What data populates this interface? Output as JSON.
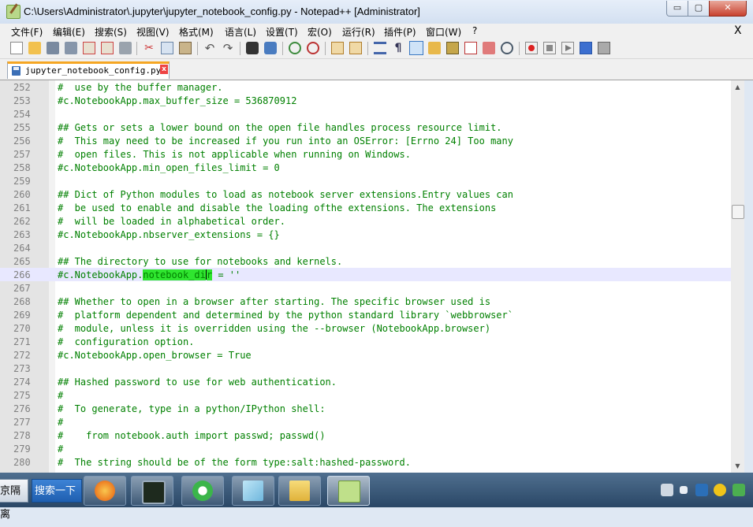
{
  "window": {
    "title": "C:\\Users\\Administrator\\.jupyter\\jupyter_notebook_config.py - Notepad++ [Administrator]",
    "min_glyph": "▭",
    "max_glyph": "▢",
    "close_glyph": "✕"
  },
  "menu": {
    "items": [
      "文件(F)",
      "编辑(E)",
      "搜索(S)",
      "视图(V)",
      "格式(M)",
      "语言(L)",
      "设置(T)",
      "宏(O)",
      "运行(R)",
      "插件(P)",
      "窗口(W)",
      "?"
    ],
    "close_glyph": "X"
  },
  "toolbar": {
    "icons": [
      "new-file-icon",
      "open-file-icon",
      "save-icon",
      "save-all-icon",
      "close-icon",
      "close-all-icon",
      "print-icon",
      "cut-icon",
      "copy-icon",
      "paste-icon",
      "undo-icon",
      "redo-icon",
      "find-icon",
      "replace-icon",
      "zoom-in-icon",
      "zoom-out-icon",
      "sync-vertical-icon",
      "sync-horizontal-icon",
      "word-wrap-icon",
      "show-all-chars-icon",
      "indent-guide-icon",
      "user-lang-icon",
      "doc-map-icon",
      "function-list-icon",
      "folder-workspace-icon",
      "monitor-icon",
      "record-macro-icon",
      "stop-record-icon",
      "play-macro-icon",
      "run-macro-multiple-icon",
      "save-macro-icon"
    ]
  },
  "tab": {
    "label": "jupyter_notebook_config.py",
    "close_glyph": "x"
  },
  "editor": {
    "lines": [
      {
        "n": "252",
        "text": "#  use by the buffer manager."
      },
      {
        "n": "253",
        "text": "#c.NotebookApp.max_buffer_size = 536870912"
      },
      {
        "n": "254",
        "text": ""
      },
      {
        "n": "255",
        "text": "## Gets or sets a lower bound on the open file handles process resource limit."
      },
      {
        "n": "256",
        "text": "#  This may need to be increased if you run into an OSError: [Errno 24] Too many"
      },
      {
        "n": "257",
        "text": "#  open files. This is not applicable when running on Windows."
      },
      {
        "n": "258",
        "text": "#c.NotebookApp.min_open_files_limit = 0"
      },
      {
        "n": "259",
        "text": ""
      },
      {
        "n": "260",
        "text": "## Dict of Python modules to load as notebook server extensions.Entry values can"
      },
      {
        "n": "261",
        "text": "#  be used to enable and disable the loading ofthe extensions. The extensions"
      },
      {
        "n": "262",
        "text": "#  will be loaded in alphabetical order."
      },
      {
        "n": "263",
        "text": "#c.NotebookApp.nbserver_extensions = {}"
      },
      {
        "n": "264",
        "text": ""
      },
      {
        "n": "265",
        "text": "## The directory to use for notebooks and kernels."
      },
      {
        "n": "266",
        "text": "",
        "pre": "#c.NotebookApp.",
        "hl1": "notebook_di",
        "hl2": "r",
        "post": " = ''"
      },
      {
        "n": "267",
        "text": ""
      },
      {
        "n": "268",
        "text": "## Whether to open in a browser after starting. The specific browser used is"
      },
      {
        "n": "269",
        "text": "#  platform dependent and determined by the python standard library `webbrowser`"
      },
      {
        "n": "270",
        "text": "#  module, unless it is overridden using the --browser (NotebookApp.browser)"
      },
      {
        "n": "271",
        "text": "#  configuration option."
      },
      {
        "n": "272",
        "text": "#c.NotebookApp.open_browser = True"
      },
      {
        "n": "273",
        "text": ""
      },
      {
        "n": "274",
        "text": "## Hashed password to use for web authentication."
      },
      {
        "n": "275",
        "text": "#"
      },
      {
        "n": "276",
        "text": "#  To generate, type in a python/IPython shell:"
      },
      {
        "n": "277",
        "text": "#"
      },
      {
        "n": "278",
        "text": "#    from notebook.auth import passwd; passwd()"
      },
      {
        "n": "279",
        "text": "#"
      },
      {
        "n": "280",
        "text": "#  The string should be of the form type:salt:hashed-password."
      }
    ]
  },
  "taskbar": {
    "chip_left": "京隔离",
    "search_label": "搜索一下",
    "apps": [
      "firefox-icon",
      "terminal-icon",
      "browser-e-icon",
      "notepad-icon",
      "file-explorer-icon",
      "notepadpp-icon"
    ]
  },
  "colors": {
    "comment": "#008000",
    "line_number": "#808080",
    "current_line": "#e8e8ff",
    "match_highlight": "#2fe52f",
    "tab_accent": "#f5a623"
  }
}
